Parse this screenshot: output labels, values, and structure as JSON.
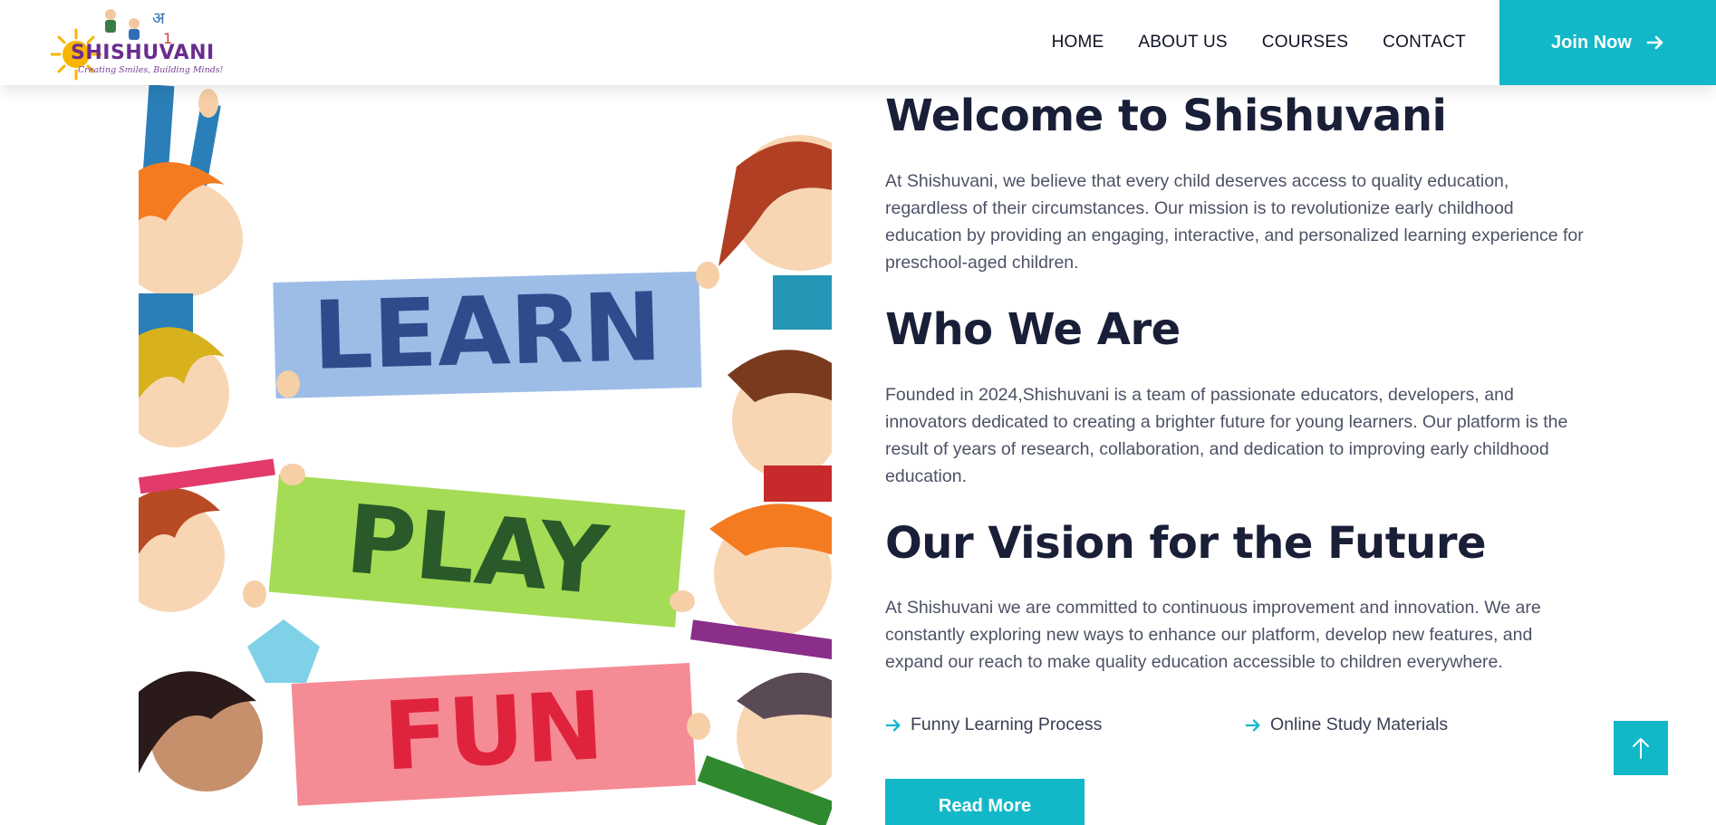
{
  "brand": {
    "name": "SHISHUVANI",
    "tagline": "Creating Smiles, Building Minds!"
  },
  "nav": {
    "items": [
      {
        "label": "HOME"
      },
      {
        "label": "ABOUT US"
      },
      {
        "label": "COURSES"
      },
      {
        "label": "CONTACT"
      }
    ],
    "join_label": "Join Now"
  },
  "illustration": {
    "signs": [
      "LEARN",
      "PLAY",
      "FUN"
    ]
  },
  "sections": [
    {
      "title": "Welcome to Shishuvani",
      "text": "At Shishuvani, we believe that every child deserves access to quality education, regardless of their circumstances. Our mission is to revolutionize early childhood education by providing an engaging, interactive, and personalized learning experience for preschool-aged children."
    },
    {
      "title": "Who We Are",
      "text": "Founded in 2024,Shishuvani is a team of passionate educators, developers, and innovators dedicated to creating a brighter future for young learners. Our platform is the result of years of research, collaboration, and dedication to improving early childhood education."
    },
    {
      "title": "Our Vision for the Future",
      "text": "At Shishuvani we are committed to continuous improvement and innovation. We are constantly exploring new ways to enhance our platform, develop new features, and expand our reach to make quality education accessible to children everywhere."
    }
  ],
  "features": [
    {
      "label": "Funny Learning Process"
    },
    {
      "label": "Online Study Materials"
    }
  ],
  "read_more_label": "Read More",
  "colors": {
    "accent": "#12b8c8",
    "heading": "#1a1f38",
    "body": "#4d5266"
  },
  "icons": {
    "join": "arrow-right-icon",
    "feature": "arrow-right-icon",
    "to_top": "arrow-up-icon"
  }
}
